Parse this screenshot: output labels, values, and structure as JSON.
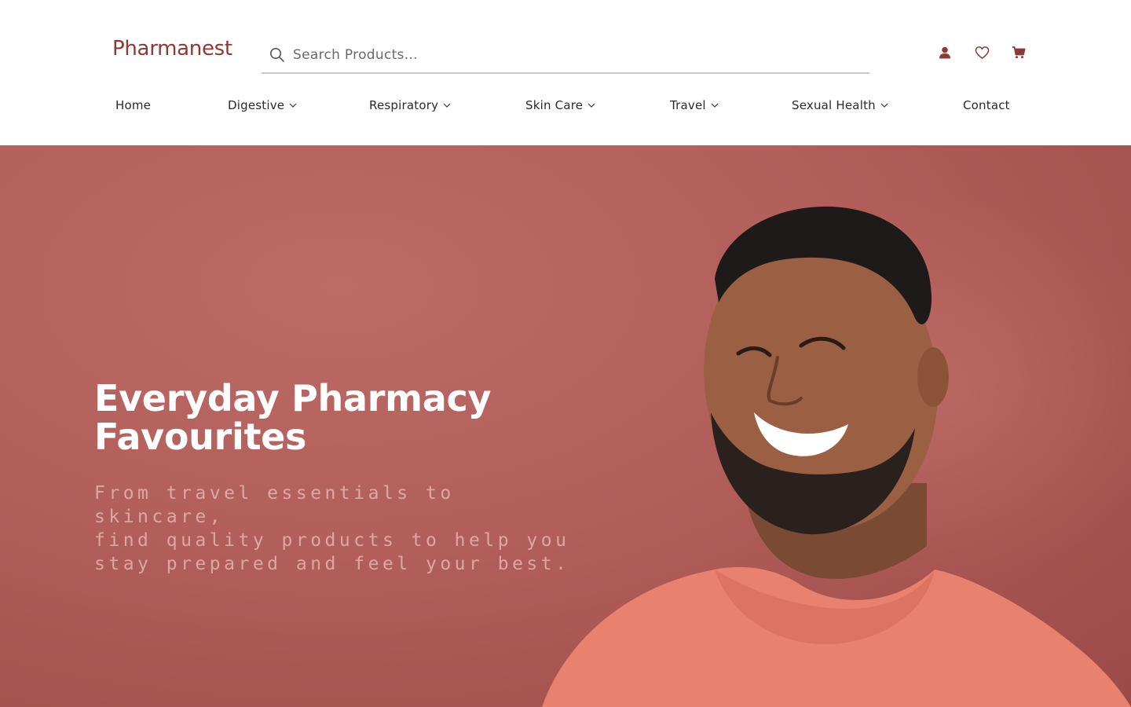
{
  "brand": {
    "logo_text": "Pharmanest",
    "accent": "#8e3a34"
  },
  "search": {
    "placeholder": "Search Products...",
    "icon": "search-icon"
  },
  "header_actions": [
    {
      "name": "account",
      "icon": "user-icon"
    },
    {
      "name": "wishlist",
      "icon": "heart-icon"
    },
    {
      "name": "cart",
      "icon": "cart-icon"
    }
  ],
  "nav": {
    "items": [
      {
        "label": "Home",
        "has_dropdown": false
      },
      {
        "label": "Digestive",
        "has_dropdown": true
      },
      {
        "label": "Respiratory",
        "has_dropdown": true
      },
      {
        "label": "Skin Care",
        "has_dropdown": true
      },
      {
        "label": "Travel",
        "has_dropdown": true
      },
      {
        "label": "Sexual Health",
        "has_dropdown": true
      },
      {
        "label": "Contact",
        "has_dropdown": false
      }
    ]
  },
  "hero": {
    "title_line1": "Everyday Pharmacy",
    "title_line2": "Favourites",
    "subtitle_line1": "From travel essentials to skincare,",
    "subtitle_line2": "find quality products to help you",
    "subtitle_line3": "stay prepared and feel your best.",
    "background_color": "#b25e5b"
  }
}
